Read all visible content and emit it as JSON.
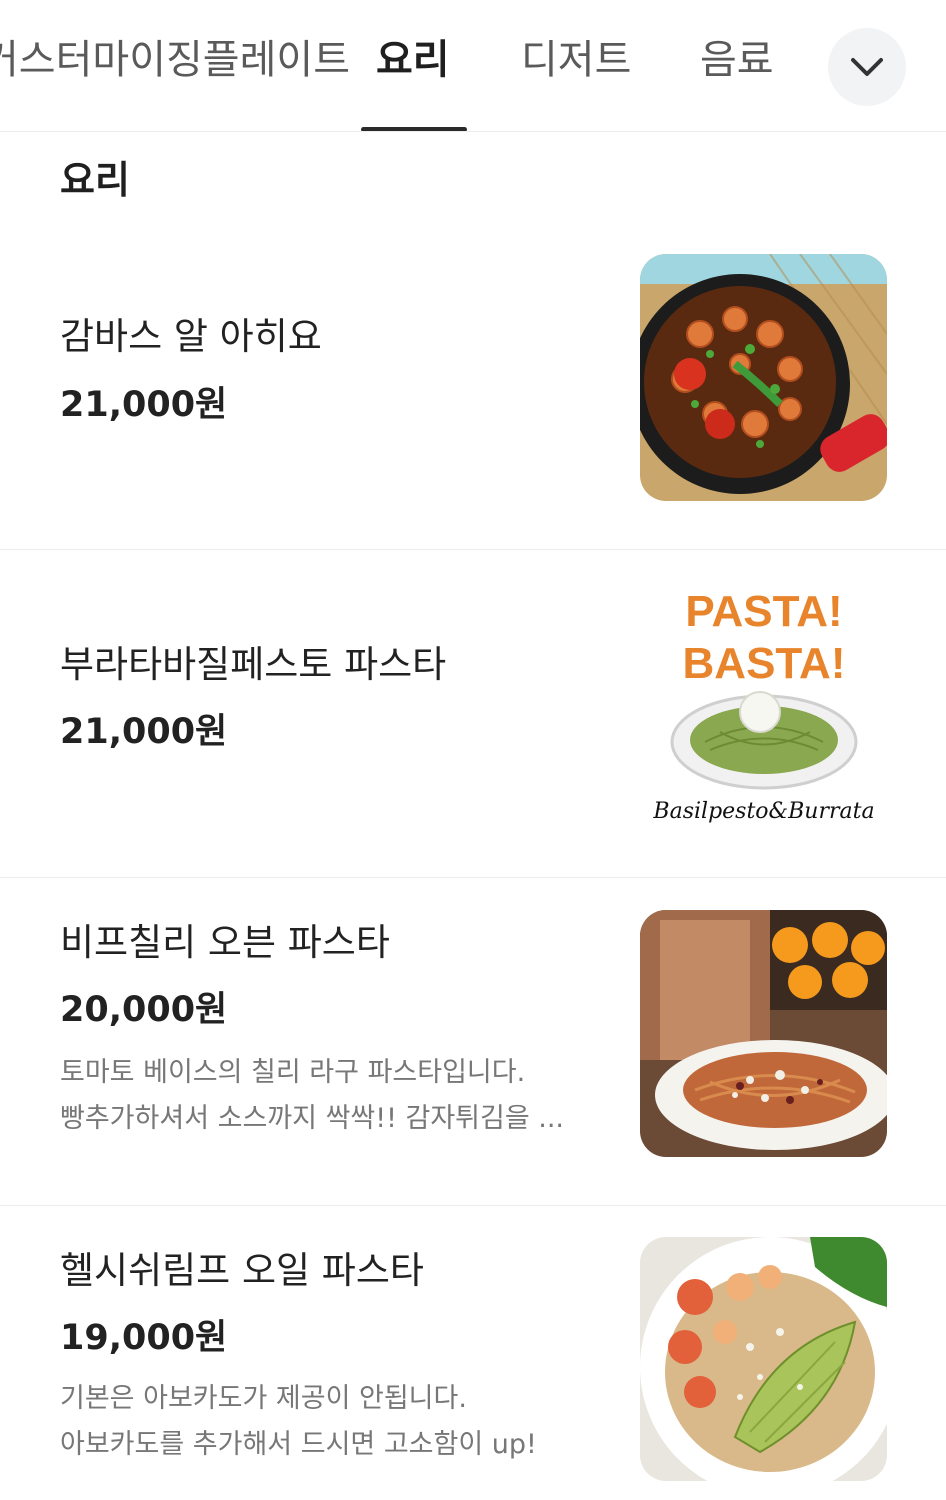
{
  "tabs": [
    {
      "label": "커스터마이징플레이트",
      "active": false
    },
    {
      "label": "요리",
      "active": true
    },
    {
      "label": "디저트",
      "active": false
    },
    {
      "label": "음료",
      "active": false
    }
  ],
  "tabbar": {
    "more_icon": "chevron-down-icon"
  },
  "section": {
    "title": "요리"
  },
  "items": [
    {
      "name": "감바스 알 아히요",
      "price": "21,000원",
      "desc": []
    },
    {
      "name": "부라타바질페스토 파스타",
      "price": "21,000원",
      "desc": [],
      "image_text": {
        "line1": "PASTA!",
        "line2": "BASTA!",
        "caption": "Basilpesto&Burrata"
      }
    },
    {
      "name": "비프칠리 오븐 파스타",
      "price": "20,000원",
      "desc": [
        "토마토 베이스의 칠리 라구 파스타입니다.",
        "빵추가하셔서 소스까지 싹싹!! 감자튀김을 ..."
      ]
    },
    {
      "name": "헬시쉬림프 오일 파스타",
      "price": "19,000원",
      "desc": [
        "기본은 아보카도가 제공이 안됩니다.",
        "아보카도를 추가해서 드시면 고소함이 up!"
      ]
    }
  ],
  "colors": {
    "accent": "#2a2a2a",
    "pasta_logo": "#e8842c"
  }
}
